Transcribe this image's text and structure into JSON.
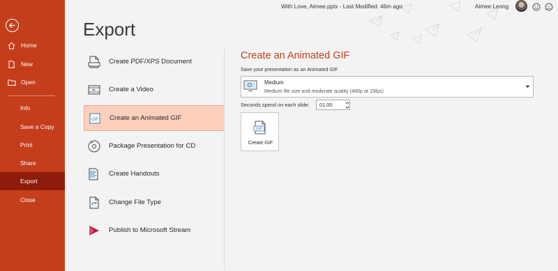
{
  "window": {
    "title": "With Love, Aimee.pptx  -  Last Modified: 46m ago",
    "user": "Aimee Leong"
  },
  "sidebar": {
    "items": [
      {
        "label": "Home"
      },
      {
        "label": "New"
      },
      {
        "label": "Open"
      },
      {
        "label": "Info"
      },
      {
        "label": "Save a Copy"
      },
      {
        "label": "Print"
      },
      {
        "label": "Share"
      },
      {
        "label": "Export"
      },
      {
        "label": "Close"
      }
    ]
  },
  "page": {
    "title": "Export"
  },
  "export_options": [
    {
      "label": "Create PDF/XPS Document",
      "icon": "document-icon"
    },
    {
      "label": "Create a Video",
      "icon": "film-icon"
    },
    {
      "label": "Create an Animated GIF",
      "icon": "gif-icon"
    },
    {
      "label": "Package Presentation for CD",
      "icon": "disc-icon"
    },
    {
      "label": "Create Handouts",
      "icon": "handouts-icon"
    },
    {
      "label": "Change File Type",
      "icon": "change-file-icon"
    },
    {
      "label": "Publish to Microsoft Stream",
      "icon": "stream-icon"
    }
  ],
  "gif_panel": {
    "title": "Create an Animated GIF",
    "subtitle": "Save your presentation as an Animated GIF",
    "quality": {
      "title": "Medium",
      "description": "Medium file size and moderate quality (480p at 15fps)"
    },
    "seconds_label": "Seconds spend on each slide:",
    "seconds_value": "01.00",
    "button_label": "Create GIF"
  },
  "colors": {
    "accent": "#c43e1c",
    "active_nav": "#8e1c0b",
    "selected_option": "#fcd0bc"
  }
}
